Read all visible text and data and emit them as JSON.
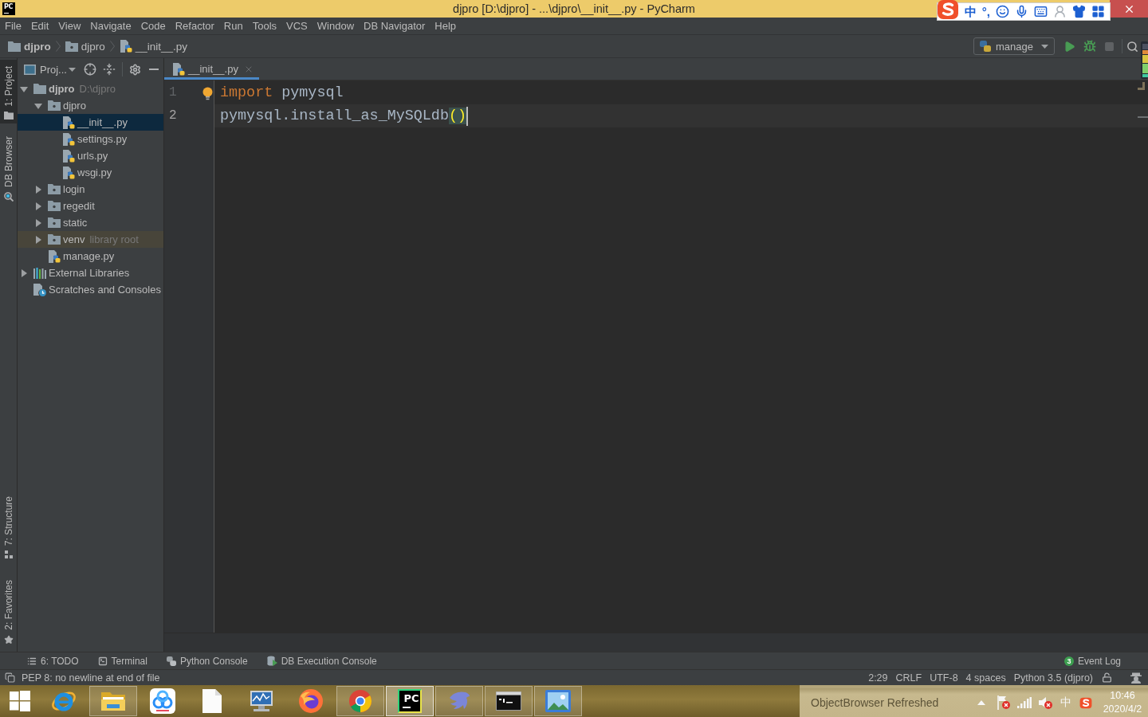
{
  "title_bar": {
    "logo": "PC",
    "title": "djpro [D:\\djpro] - ...\\djpro\\__init__.py - PyCharm"
  },
  "ime_toolbar": {
    "mode": "中",
    "punctuation": "°,"
  },
  "menu_bar": {
    "items": [
      "File",
      "Edit",
      "View",
      "Navigate",
      "Code",
      "Refactor",
      "Run",
      "Tools",
      "VCS",
      "Window",
      "DB Navigator",
      "Help"
    ]
  },
  "navigation_bar": {
    "breadcrumbs": [
      {
        "label": "djpro",
        "kind": "project"
      },
      {
        "label": "djpro",
        "kind": "package"
      },
      {
        "label": "__init__.py",
        "kind": "python_file"
      }
    ],
    "run_configuration": "manage"
  },
  "tool_stripe": {
    "top": [
      {
        "label": "1: Project",
        "kind": "project",
        "selected": true
      },
      {
        "label": "DB Browser",
        "kind": "db_browser",
        "selected": false
      }
    ],
    "bottom": [
      {
        "label": "7: Structure",
        "kind": "structure",
        "selected": false
      },
      {
        "label": "2: Favorites",
        "kind": "favorites",
        "selected": false
      }
    ]
  },
  "project_panel": {
    "view": "Proj...",
    "tree": [
      {
        "label": "djpro",
        "hint": "D:\\djpro",
        "kind": "project",
        "expanded": true,
        "selected": false,
        "highlighted": false,
        "children": [
          {
            "label": "djpro",
            "kind": "package",
            "expanded": true,
            "selected": false,
            "highlighted": false,
            "children": [
              {
                "label": "__init__.py",
                "kind": "python_file",
                "selected": true,
                "highlighted": false
              },
              {
                "label": "settings.py",
                "kind": "python_file",
                "selected": false,
                "highlighted": false
              },
              {
                "label": "urls.py",
                "kind": "python_file",
                "selected": false,
                "highlighted": false
              },
              {
                "label": "wsgi.py",
                "kind": "python_file",
                "selected": false,
                "highlighted": false
              }
            ]
          },
          {
            "label": "login",
            "kind": "package",
            "expanded": false,
            "selected": false,
            "highlighted": false
          },
          {
            "label": "regedit",
            "kind": "package",
            "expanded": false,
            "selected": false,
            "highlighted": false
          },
          {
            "label": "static",
            "kind": "package",
            "expanded": false,
            "selected": false,
            "highlighted": false
          },
          {
            "label": "venv",
            "hint": "library root",
            "kind": "package",
            "expanded": false,
            "selected": false,
            "highlighted": true
          },
          {
            "label": "manage.py",
            "kind": "python_file",
            "selected": false,
            "highlighted": false
          }
        ]
      },
      {
        "label": "External Libraries",
        "kind": "libraries",
        "expanded": false,
        "selected": false,
        "highlighted": false
      },
      {
        "label": "Scratches and Consoles",
        "kind": "scratches",
        "selected": false,
        "highlighted": false
      }
    ]
  },
  "editor": {
    "tabs": [
      {
        "label": "__init__.py",
        "selected": true
      }
    ],
    "lines": [
      {
        "number": "1",
        "current": false,
        "intention_bulb": true,
        "tokens": [
          {
            "text": "import",
            "kind": "keyword"
          },
          {
            "text": " pymysql",
            "kind": "identifier"
          }
        ]
      },
      {
        "number": "2",
        "current": true,
        "intention_bulb": false,
        "tokens": [
          {
            "text": "pymysql.install_as_MySQLdb",
            "kind": "identifier"
          },
          {
            "text": "()",
            "kind": "matched_braces"
          }
        ]
      }
    ]
  },
  "tool_windows": {
    "left": [
      {
        "label": "6: TODO",
        "kind": "todo"
      },
      {
        "label": "Terminal",
        "kind": "terminal"
      },
      {
        "label": "Python Console",
        "kind": "python_console"
      },
      {
        "label": "DB Execution Console",
        "kind": "db_console"
      }
    ],
    "right": [
      {
        "label": "Event Log",
        "badge": "3"
      }
    ]
  },
  "status_bar": {
    "message": "PEP 8: no newline at end of file",
    "widgets": [
      "2:29",
      "CRLF",
      "UTF-8",
      "4 spaces",
      "Python 3.5 (djpro)"
    ]
  },
  "taskbar": {
    "apps": [
      {
        "kind": "ie",
        "running": false,
        "selected": false
      },
      {
        "kind": "explorer",
        "running": true,
        "selected": false
      },
      {
        "kind": "netdisk",
        "running": false,
        "selected": false
      },
      {
        "kind": "document",
        "running": false,
        "selected": false
      },
      {
        "kind": "monitor",
        "running": false,
        "selected": false
      },
      {
        "kind": "firefox",
        "running": false,
        "selected": false
      },
      {
        "kind": "chrome",
        "running": true,
        "selected": false
      },
      {
        "kind": "ide",
        "logo": "PC",
        "running": true,
        "selected": true
      },
      {
        "kind": "dolphin",
        "running": true,
        "selected": false
      },
      {
        "kind": "console",
        "running": true,
        "selected": false
      },
      {
        "kind": "photos",
        "running": true,
        "selected": false
      }
    ],
    "tray": {
      "notice": "ObjectBrowser Refreshed",
      "input_mode": "中",
      "time": "10:46",
      "date": "2020/4/2"
    }
  }
}
